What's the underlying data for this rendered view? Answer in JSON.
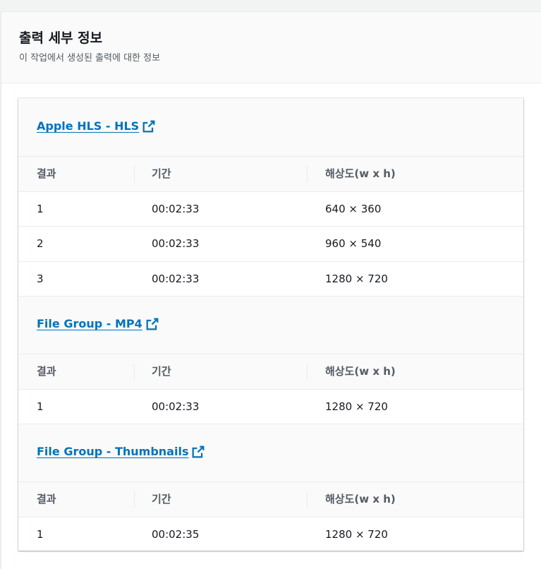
{
  "panel": {
    "title": "출력 세부 정보",
    "description": "이 작업에서 생성된 출력에 대한 정보"
  },
  "columns": {
    "result": "결과",
    "duration": "기간",
    "resolution": "해상도(w x h)"
  },
  "groups": [
    {
      "name": "Apple HLS - HLS",
      "rows": [
        {
          "result": "1",
          "duration": "00:02:33",
          "resolution": "640 × 360"
        },
        {
          "result": "2",
          "duration": "00:02:33",
          "resolution": "960 × 540"
        },
        {
          "result": "3",
          "duration": "00:02:33",
          "resolution": "1280 × 720"
        }
      ]
    },
    {
      "name": "File Group - MP4",
      "rows": [
        {
          "result": "1",
          "duration": "00:02:33",
          "resolution": "1280 × 720"
        }
      ]
    },
    {
      "name": "File Group - Thumbnails",
      "rows": [
        {
          "result": "1",
          "duration": "00:02:35",
          "resolution": "1280 × 720"
        }
      ]
    }
  ],
  "colors": {
    "link": "#0073bb",
    "header_text": "#545b64",
    "body_text": "#16191f",
    "border": "#eaeded"
  },
  "icons": {
    "external_link": "external-link-icon"
  }
}
